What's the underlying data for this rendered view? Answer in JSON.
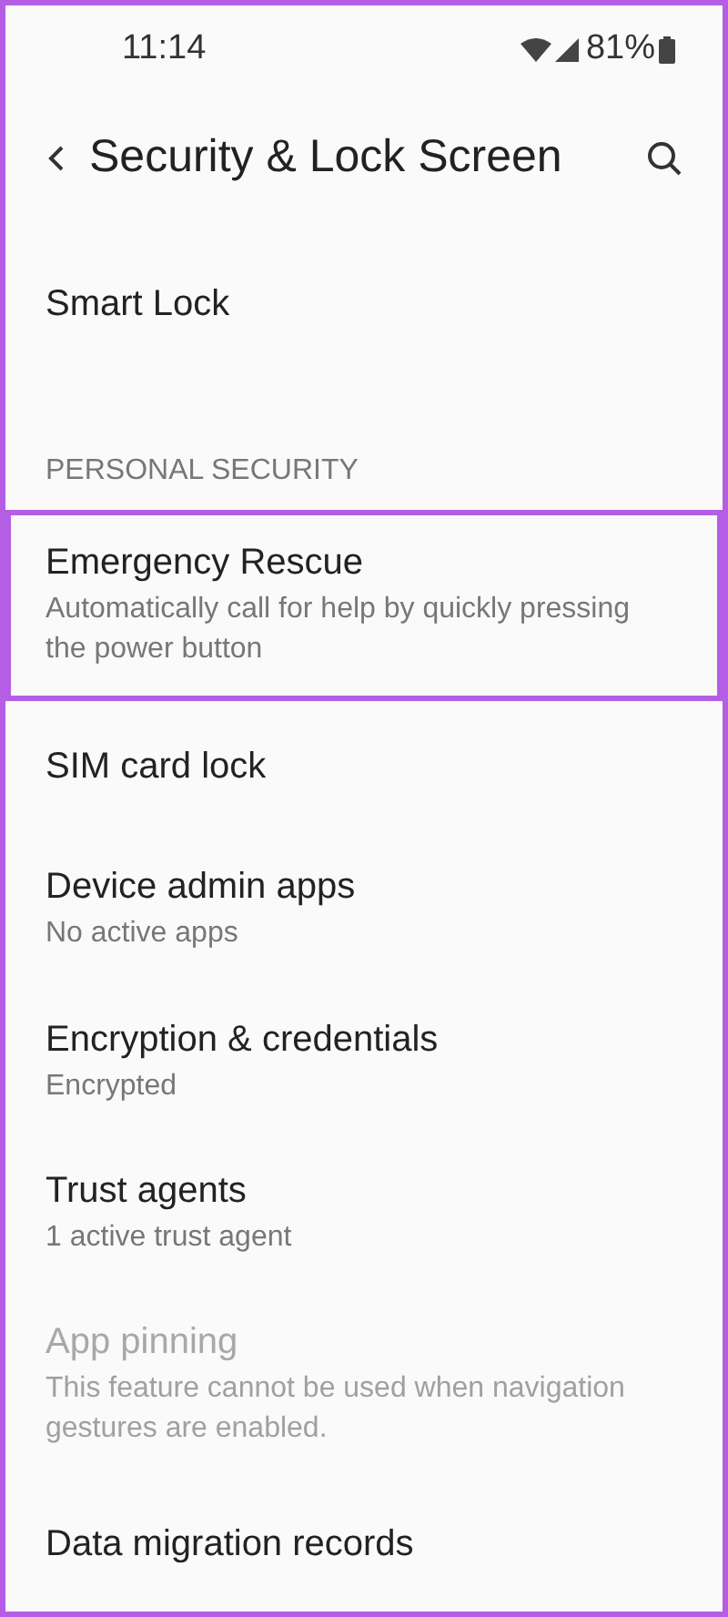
{
  "status_bar": {
    "time": "11:14",
    "battery": "81%"
  },
  "header": {
    "title": "Security & Lock Screen"
  },
  "items_top": [
    {
      "title": "Smart Lock",
      "disabled": false,
      "highlighted": false
    }
  ],
  "section": {
    "title": "PERSONAL SECURITY"
  },
  "items": [
    {
      "title": "Emergency Rescue",
      "subtitle": "Automatically call for help by quickly pressing the power button",
      "disabled": false,
      "highlighted": true
    },
    {
      "title": "SIM card lock",
      "disabled": false,
      "highlighted": false
    },
    {
      "title": "Device admin apps",
      "subtitle": "No active apps",
      "disabled": false,
      "highlighted": false
    },
    {
      "title": "Encryption & credentials",
      "subtitle": "Encrypted",
      "disabled": false,
      "highlighted": false
    },
    {
      "title": "Trust agents",
      "subtitle": "1 active trust agent",
      "disabled": false,
      "highlighted": false
    },
    {
      "title": "App pinning",
      "subtitle": "This feature cannot be used when navigation gestures are enabled.",
      "disabled": true,
      "highlighted": false
    },
    {
      "title": "Data migration records",
      "disabled": false,
      "highlighted": false
    }
  ]
}
